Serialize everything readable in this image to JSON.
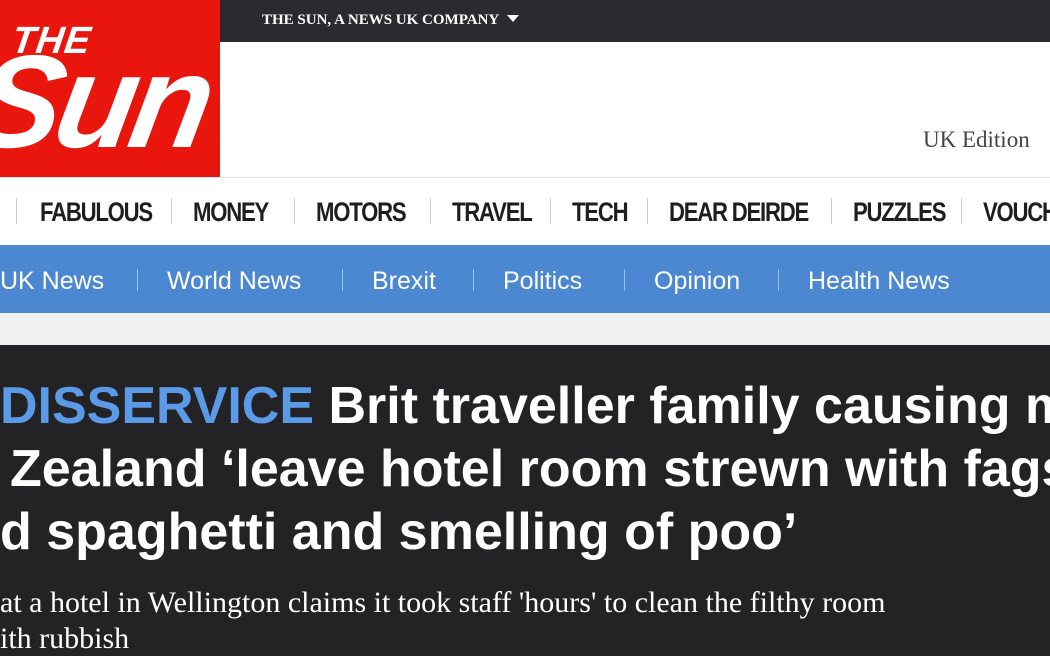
{
  "topbar": {
    "company": "THE SUN, A NEWS UK COMPANY"
  },
  "logo": {
    "the": "THE",
    "sun": "Sun"
  },
  "edition": "UK Edition",
  "main_nav": [
    "FABULOUS",
    "MONEY",
    "MOTORS",
    "TRAVEL",
    "TECH",
    "DEAR DEIRDE",
    "PUZZLES",
    "VOUCH"
  ],
  "sub_nav": {
    "items": [
      "UK News",
      "World News",
      "Brexit",
      "Politics",
      "Opinion",
      "Health News"
    ],
    "active": "World News"
  },
  "article": {
    "kicker": "DISSERVICE",
    "headline_line1": "Brit traveller family causing m",
    "headline_line2": "Zealand ‘leave hotel room strewn with fags",
    "headline_line3": "d spaghetti and smelling of poo’",
    "standfirst_line1": "at a hotel in Wellington claims it took staff 'hours' to clean the filthy room",
    "standfirst_line2": "ith rubbish"
  },
  "colors": {
    "brand_red": "#e8160c",
    "nav_blue": "#4c88d1",
    "kicker_blue": "#5a9ae6",
    "dark_bg": "#232326"
  }
}
